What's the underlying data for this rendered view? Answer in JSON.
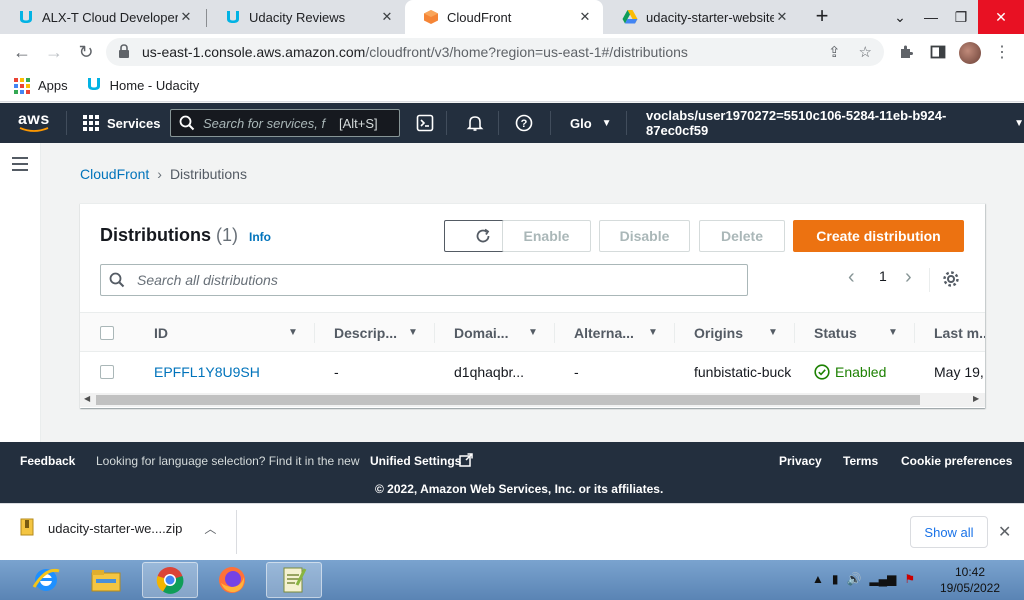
{
  "browser": {
    "tabs": [
      {
        "label": "ALX-T Cloud Developer -",
        "icon": "udacity-logo-icon",
        "active": false
      },
      {
        "label": "Udacity Reviews",
        "icon": "udacity-logo-icon",
        "active": false
      },
      {
        "label": "CloudFront",
        "icon": "cloudfront-cube-icon",
        "active": true
      },
      {
        "label": "udacity-starter-website.z",
        "icon": "google-drive-icon",
        "active": false
      }
    ],
    "url_host": "us-east-1.console.aws.amazon.com",
    "url_path": "/cloudfront/v3/home?region=us-east-1#/distributions",
    "bookmarks": [
      {
        "label": "Apps",
        "icon": "apps-grid-icon"
      },
      {
        "label": "Home - Udacity",
        "icon": "udacity-logo-icon"
      }
    ]
  },
  "aws_nav": {
    "logo": "aws",
    "services_label": "Services",
    "search_placeholder": "Search for services, f",
    "search_shortcut": "[Alt+S]",
    "region_label": "Glo",
    "account_label": "voclabs/user1970272=5510c106-5284-11eb-b924-87ec0cf59"
  },
  "breadcrumb": {
    "parent": "CloudFront",
    "current": "Distributions"
  },
  "panel": {
    "title": "Distributions",
    "count": "(1)",
    "info_label": "Info",
    "enable_label": "Enable",
    "disable_label": "Disable",
    "delete_label": "Delete",
    "create_label": "Create distribution",
    "search_placeholder": "Search all distributions",
    "page_number": "1"
  },
  "table": {
    "columns": [
      "ID",
      "Descrip...",
      "Domai...",
      "Alterna...",
      "Origins",
      "Status",
      "Last m..."
    ],
    "rows": [
      {
        "id": "EPFFL1Y8U9SH",
        "description": "-",
        "domain": "d1qhaqbr...",
        "alternate": "-",
        "origins": "funbistatic-buck",
        "status": "Enabled",
        "last_modified": "May 19,"
      }
    ]
  },
  "footer": {
    "feedback": "Feedback",
    "language_prompt": "Looking for language selection? Find it in the new",
    "unified_settings": "Unified Settings",
    "privacy": "Privacy",
    "terms": "Terms",
    "cookie": "Cookie preferences",
    "copyright": "© 2022, Amazon Web Services, Inc. or its affiliates."
  },
  "downloads": {
    "file_name": "udacity-starter-we....zip",
    "show_all": "Show all"
  },
  "taskbar": {
    "time": "10:42",
    "date": "19/05/2022"
  },
  "colors": {
    "aws_nav_bg": "#232f3e",
    "primary_orange": "#ec7211",
    "link_blue": "#0073bb",
    "status_green": "#1d8102"
  }
}
